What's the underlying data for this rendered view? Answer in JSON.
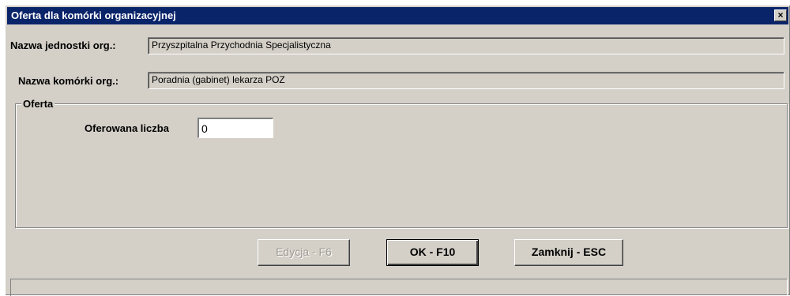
{
  "window": {
    "title": "Oferta dla komórki organizacyjnej",
    "close_glyph": "×"
  },
  "fields": {
    "unit_label": "Nazwa jednostki org.:",
    "unit_value": "Przyszpitalna Przychodnia Specjalistyczna",
    "cell_label": "Nazwa komórki org.:",
    "cell_value": "Poradnia (gabinet) lekarza POZ"
  },
  "offer_group": {
    "legend": "Oferta",
    "count_label": "Oferowana liczba",
    "count_value": "0"
  },
  "buttons": {
    "edit_label": "Edycja - F6",
    "ok_label": "OK - F10",
    "close_label": "Zamknij - ESC"
  },
  "colors": {
    "titlebar": "#0a246a",
    "dialog_face": "#d4d0c8"
  },
  "icons": {
    "close": "close-icon"
  }
}
